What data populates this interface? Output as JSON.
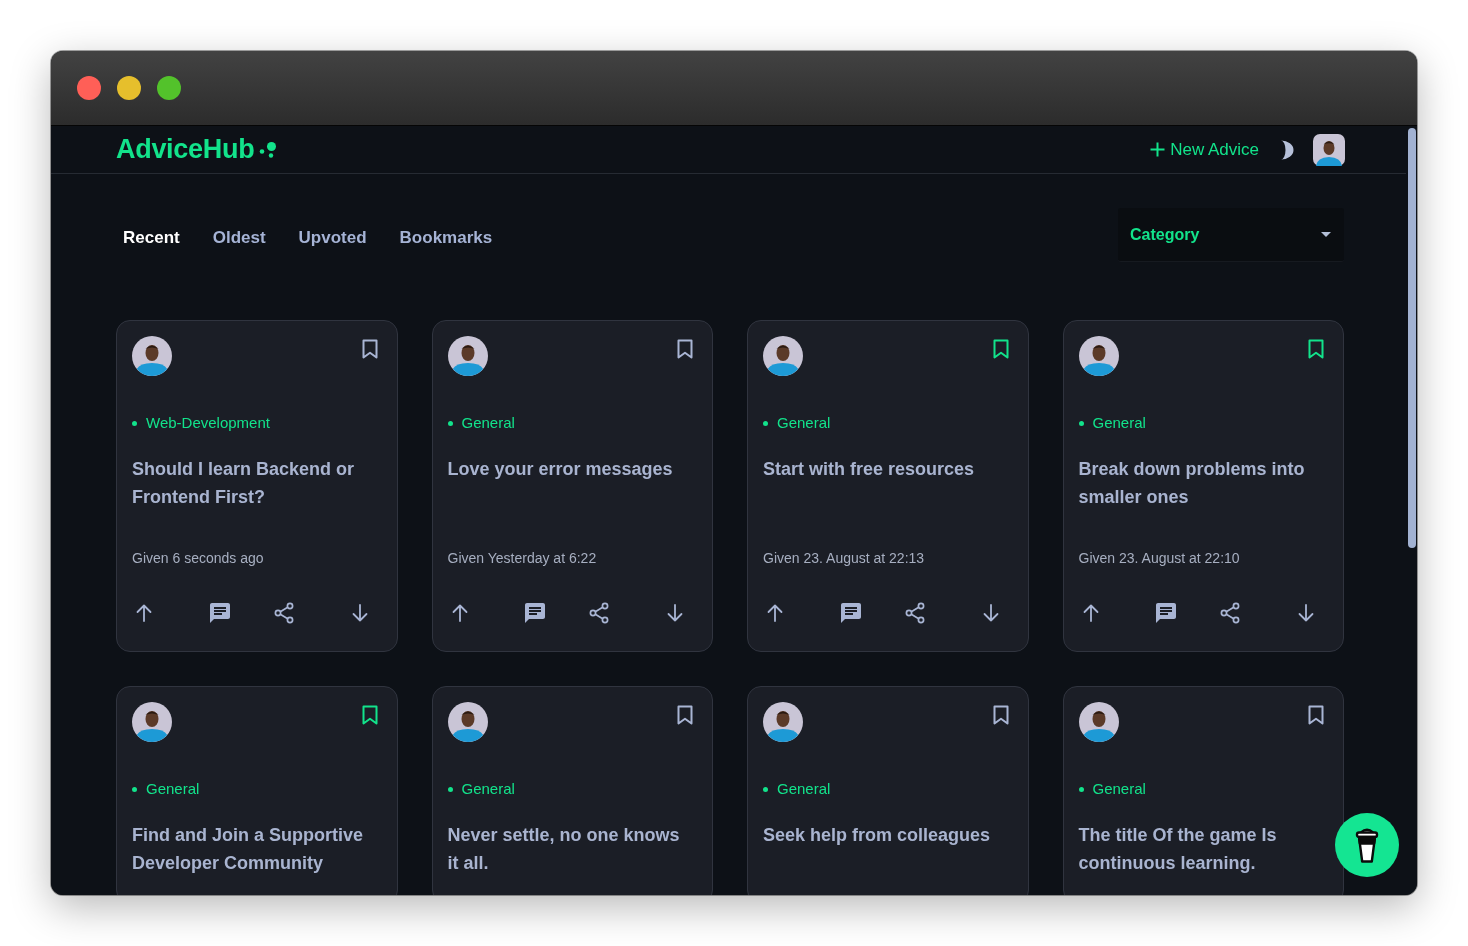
{
  "header": {
    "logo": "AdviceHub",
    "new_advice_button": "New Advice"
  },
  "tabs": [
    {
      "label": "Recent",
      "selected": true
    },
    {
      "label": "Oldest",
      "selected": false
    },
    {
      "label": "Upvoted",
      "selected": false
    },
    {
      "label": "Bookmarks",
      "selected": false
    }
  ],
  "category_dropdown": {
    "label": "Category"
  },
  "cards": [
    {
      "category": "Web-Development",
      "title": "Should I learn Backend or Frontend First?",
      "date": "Given 6 seconds ago",
      "bookmarked": false
    },
    {
      "category": "General",
      "title": "Love your error messages",
      "date": "Given Yesterday at 6:22",
      "bookmarked": false
    },
    {
      "category": "General",
      "title": "Start with free resources",
      "date": "Given 23. August at 22:13",
      "bookmarked": true
    },
    {
      "category": "General",
      "title": "Break down problems into smaller ones",
      "date": "Given 23. August at 22:10",
      "bookmarked": true
    },
    {
      "category": "General",
      "title": "Find and Join a Supportive Developer Community",
      "bookmarked": true
    },
    {
      "category": "General",
      "title": "Never settle, no one knows it all.",
      "bookmarked": false
    },
    {
      "category": "General",
      "title": "Seek help from colleagues",
      "bookmarked": false
    },
    {
      "category": "General",
      "title": "The title Of the game Is continuous learning.",
      "bookmarked": false
    }
  ]
}
